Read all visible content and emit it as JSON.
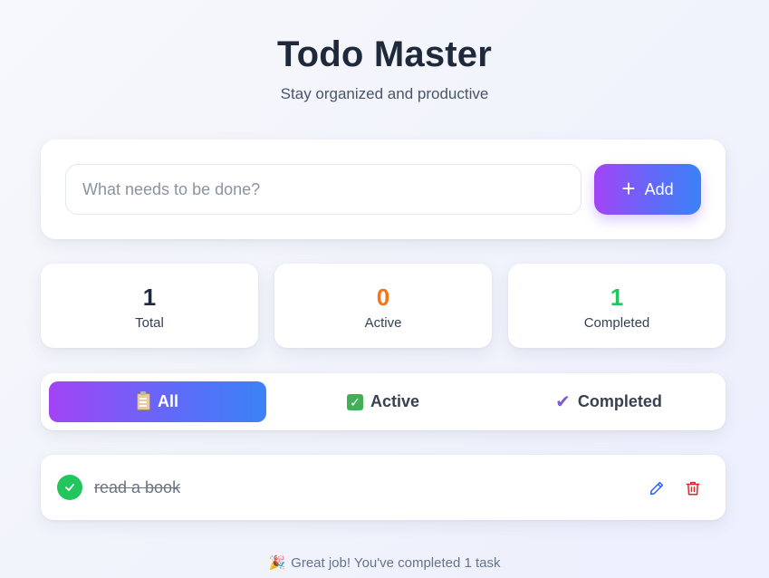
{
  "header": {
    "title": "Todo Master",
    "subtitle": "Stay organized and productive"
  },
  "input": {
    "placeholder": "What needs to be done?",
    "value": "",
    "add_label": "Add",
    "add_icon": "plus-icon"
  },
  "stats": [
    {
      "value": "1",
      "label": "Total",
      "color": "#1e293b"
    },
    {
      "value": "0",
      "label": "Active",
      "color": "#f97316"
    },
    {
      "value": "1",
      "label": "Completed",
      "color": "#22c55e"
    }
  ],
  "filters": [
    {
      "label": "All",
      "icon": "clipboard-icon",
      "selected": true
    },
    {
      "label": "Active",
      "icon": "checkbox-icon",
      "selected": false
    },
    {
      "label": "Completed",
      "icon": "checkmark-icon",
      "selected": false
    }
  ],
  "todos": [
    {
      "text": "read a book",
      "completed": true
    }
  ],
  "footer": {
    "message": "Great job! You've completed 1 task",
    "icon": "party-popper-icon"
  },
  "colors": {
    "accent_gradient_start": "#a244f6",
    "accent_gradient_end": "#3b82f6",
    "completed_green": "#22c55e",
    "active_orange": "#f97316",
    "edit_blue": "#2563eb",
    "delete_red": "#dc2626"
  }
}
